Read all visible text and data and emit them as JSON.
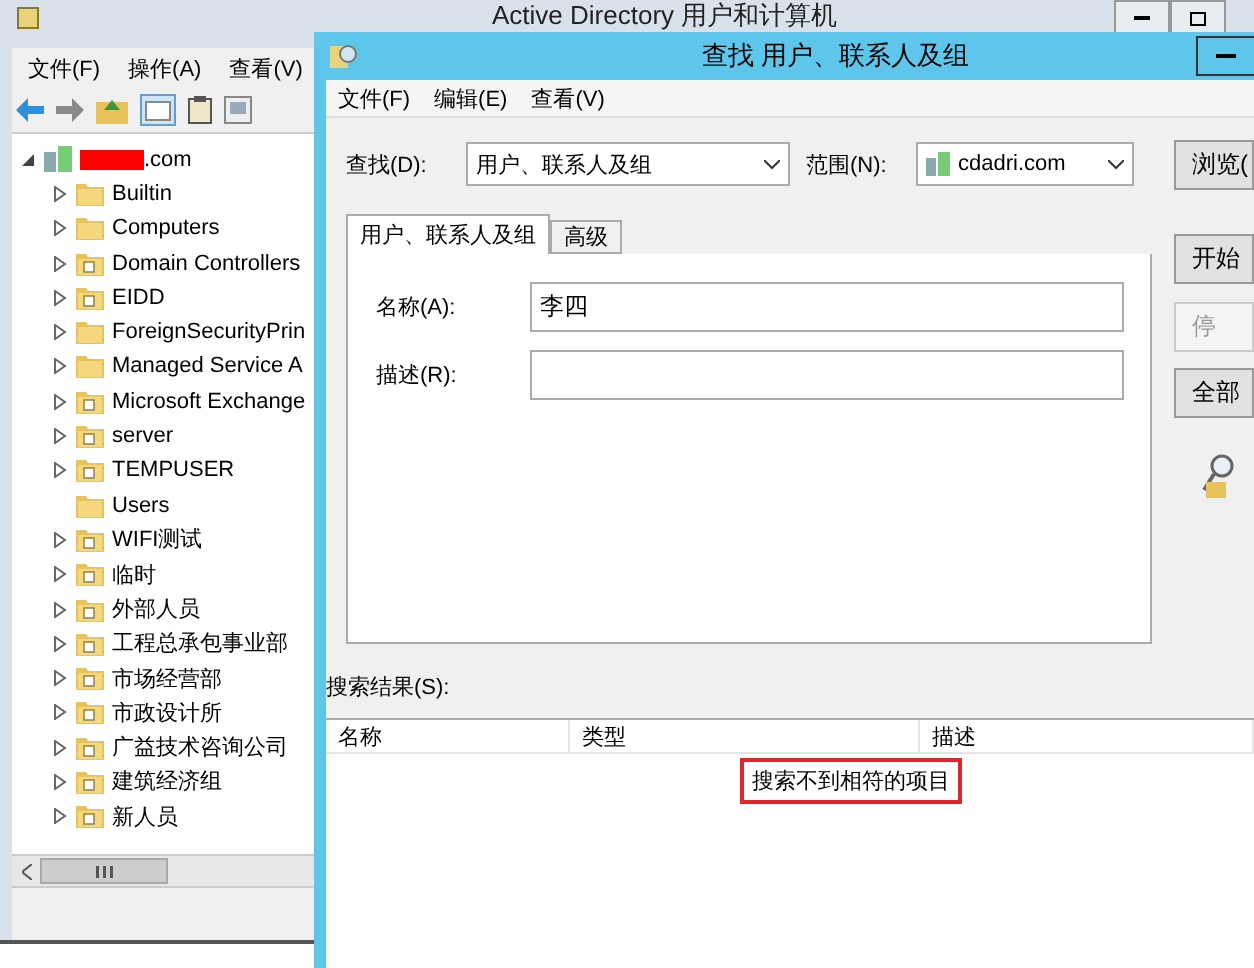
{
  "main_window": {
    "title": "Active Directory 用户和计算机",
    "menu": [
      "文件(F)",
      "操作(A)",
      "查看(V)"
    ],
    "tree": {
      "label": ".com",
      "redacted": true,
      "expanded": true,
      "children": [
        {
          "label": "Builtin",
          "expandable": true,
          "special": false
        },
        {
          "label": "Computers",
          "expandable": true,
          "special": false
        },
        {
          "label": "Domain Controllers",
          "expandable": true,
          "special": true
        },
        {
          "label": "EIDD",
          "expandable": true,
          "special": true
        },
        {
          "label": "ForeignSecurityPrin",
          "expandable": true,
          "special": false
        },
        {
          "label": "Managed Service A",
          "expandable": true,
          "special": false
        },
        {
          "label": "Microsoft Exchange",
          "expandable": true,
          "special": true
        },
        {
          "label": "server",
          "expandable": true,
          "special": true
        },
        {
          "label": "TEMPUSER",
          "expandable": true,
          "special": true
        },
        {
          "label": "Users",
          "expandable": false,
          "special": false
        },
        {
          "label": "WIFI测试",
          "expandable": true,
          "special": true
        },
        {
          "label": "临时",
          "expandable": true,
          "special": true
        },
        {
          "label": "外部人员",
          "expandable": true,
          "special": true
        },
        {
          "label": "工程总承包事业部",
          "expandable": true,
          "special": true
        },
        {
          "label": "市场经营部",
          "expandable": true,
          "special": true
        },
        {
          "label": "市政设计所",
          "expandable": true,
          "special": true
        },
        {
          "label": "广益技术咨询公司",
          "expandable": true,
          "special": true
        },
        {
          "label": "建筑经济组",
          "expandable": true,
          "special": true
        },
        {
          "label": "新人员",
          "expandable": true,
          "special": true
        }
      ]
    }
  },
  "dialog": {
    "title": "查找 用户、联系人及组",
    "menu": [
      "文件(F)",
      "编辑(E)",
      "查看(V)"
    ],
    "find": {
      "label": "查找(D):",
      "value": "用户、联系人及组"
    },
    "scope": {
      "label": "范围(N):",
      "value": "cdadri.com"
    },
    "browse_button": "浏览(",
    "tabs": [
      {
        "label": "用户、联系人及组",
        "selected": true
      },
      {
        "label": "高级",
        "selected": false
      }
    ],
    "fields": [
      {
        "label": "名称(A):",
        "value": "李四"
      },
      {
        "label": "描述(R):"
      }
    ],
    "buttons": [
      {
        "label": "开始",
        "disabled": false
      },
      {
        "label": "停",
        "disabled": true
      },
      {
        "label": "全部",
        "disabled": false
      }
    ],
    "results": {
      "label": "搜索结果(S):",
      "columns": [
        "名称",
        "类型",
        "描述"
      ],
      "message": "搜索不到相符的项目",
      "highlighted": true
    }
  }
}
